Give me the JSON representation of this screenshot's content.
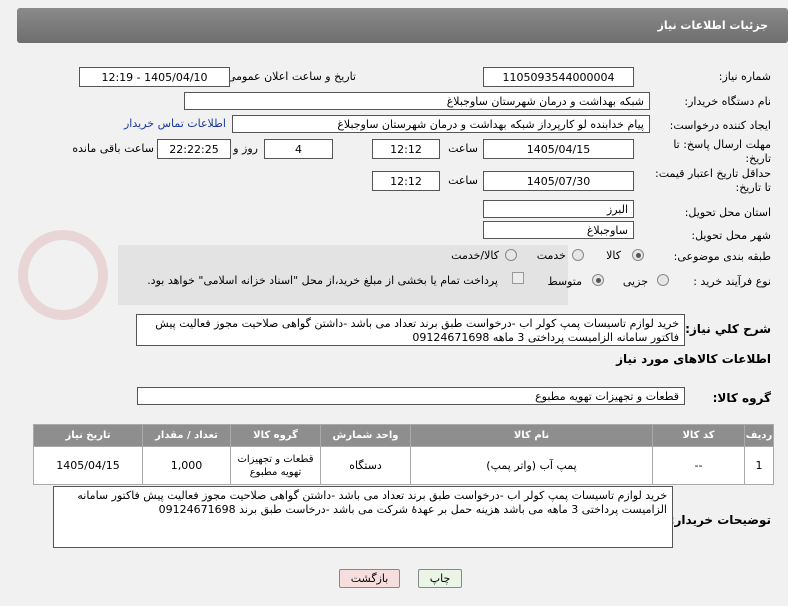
{
  "header": {
    "title": "جزئیات اطلاعات نیاز"
  },
  "fields": {
    "need_number_label": "شماره نیاز:",
    "need_number": "1105093544000004",
    "announce_label": "تاریخ و ساعت اعلان عمومی:",
    "announce_value": "1405/04/10 - 12:19",
    "buyer_org_label": "نام دستگاه خریدار:",
    "buyer_org": "شبکه بهداشت و درمان شهرستان ساوجبلاغ",
    "creator_label": "ایجاد کننده درخواست:",
    "creator": "پیام خدابنده لو کارپرداز شبکه بهداشت و درمان شهرستان ساوجبلاغ",
    "contact_link": "اطلاعات تماس خریدار",
    "deadline_label_1": "مهلت ارسال پاسخ: تا",
    "deadline_label_2": "تاریخ:",
    "deadline_date": "1405/04/15",
    "time_label": "ساعت",
    "deadline_time": "12:12",
    "days_value": "4",
    "days_label": "روز و",
    "remaining_time": "22:22:25",
    "remaining_label": "ساعت باقی مانده",
    "validity_label_1": "حداقل تاریخ اعتبار قیمت:",
    "validity_label_2": "تا تاریخ:",
    "validity_date": "1405/07/30",
    "validity_time": "12:12",
    "province_label": "استان محل تحویل:",
    "province": "البرز",
    "city_label": "شهر محل تحویل:",
    "city": "ساوجبلاغ",
    "category_label": "طبقه بندی موضوعی:",
    "category_options": [
      "کالا",
      "خدمت",
      "کالا/خدمت"
    ],
    "process_label": "نوع فرآیند خرید :",
    "process_options": [
      "جزیی",
      "متوسط"
    ],
    "payment_note": "پرداخت تمام یا بخشی از مبلغ خرید،از محل \"اسناد خزانه اسلامی\" خواهد بود.",
    "summary_label": "شرح کلي نياز:",
    "summary": "خرید لوازم تاسیسات پمپ کولر اب -درخواست طبق برند تعداد می باشد -داشتن گواهی صلاحیت مجوز فعالیت پیش فاکتور سامانه الزامیست پرداختی 3 ماهه 09124671698",
    "goods_info_title": "اطلاعات کالاهای مورد نیاز",
    "goods_group_label": "گروه کالا:",
    "goods_group": "قطعات و تجهیزات تهویه مطبوع",
    "buyer_notes_label": "توضیحات خریدار:",
    "buyer_notes": "خرید لوازم تاسیسات پمپ کولر اب -درخواست طبق برند تعداد می باشد -داشتن گواهی صلاحیت مجوز فعالیت پیش فاکتور سامانه الزامیست پرداختی 3 ماهه می باشد هزینه حمل بر عهدۀ شرکت می باشد -درخاست طبق برند  09124671698"
  },
  "table": {
    "headers": [
      "ردیف",
      "کد کالا",
      "نام کالا",
      "واحد شمارش",
      "گروه کالا",
      "تعداد / مقدار",
      "تاریخ نیاز"
    ],
    "rows": [
      [
        "1",
        "--",
        "پمپ آب (واتر پمپ)",
        "دستگاه",
        "قطعات و تجهیزات تهویه مطبوع",
        "1,000",
        "1405/04/15"
      ]
    ]
  },
  "buttons": {
    "print": "چاپ",
    "back": "بازگشت"
  },
  "colors": {
    "header_bg": "#7a7a7a",
    "print_btn": "#eaf5e6",
    "back_btn": "#f6dede",
    "link": "#1a3a9c"
  }
}
